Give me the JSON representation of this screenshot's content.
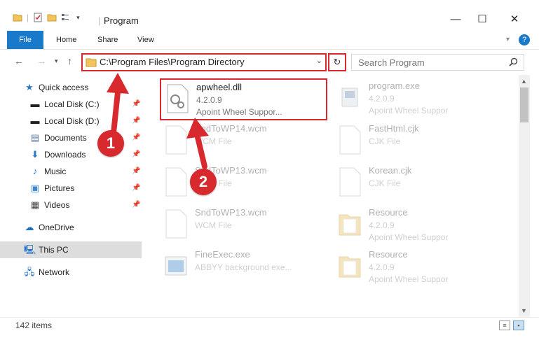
{
  "window": {
    "title": "Program",
    "minimize": "—",
    "maximize": "☐",
    "close": "✕"
  },
  "ribbon": {
    "tabs": [
      "File",
      "Home",
      "Share",
      "View"
    ],
    "help": "?"
  },
  "address": {
    "path": "C:\\Program Files\\Program Directory",
    "search_placeholder": "Search Program"
  },
  "nav_pane": {
    "items": [
      {
        "label": "Quick access",
        "icon": "star-icon"
      },
      {
        "label": "Local Disk (C:)",
        "icon": "disk-icon",
        "pinned": true
      },
      {
        "label": "Local Disk (D:)",
        "icon": "disk-icon",
        "pinned": true
      },
      {
        "label": "Documents",
        "icon": "documents-icon",
        "pinned": true
      },
      {
        "label": "Downloads",
        "icon": "download-icon",
        "pinned": true
      },
      {
        "label": "Music",
        "icon": "music-icon",
        "pinned": true
      },
      {
        "label": "Pictures",
        "icon": "pictures-icon",
        "pinned": true
      },
      {
        "label": "Videos",
        "icon": "videos-icon",
        "pinned": true
      },
      {
        "label": "OneDrive",
        "icon": "cloud-icon"
      },
      {
        "label": "This PC",
        "icon": "computer-icon",
        "selected": true
      },
      {
        "label": "Network",
        "icon": "network-icon"
      }
    ]
  },
  "files": [
    {
      "name": "apwheel.dll",
      "line2": "4.2.0.9",
      "line3": "Apoint Wheel Suppor...",
      "type": "dll",
      "highlighted": true
    },
    {
      "name": "program.exe",
      "line2": "4.2.0.9",
      "line3": "Apoint Wheel Suppor",
      "type": "exe"
    },
    {
      "name": "SndToWP14.wcm",
      "line2": "WCM File",
      "line3": "",
      "type": "blank"
    },
    {
      "name": "FastHtml.cjk",
      "line2": "CJK File",
      "line3": "",
      "type": "blank"
    },
    {
      "name": "SndToWP13.wcm",
      "line2": "WCM File",
      "line3": "",
      "type": "blank"
    },
    {
      "name": "Korean.cjk",
      "line2": "CJK File",
      "line3": "",
      "type": "blank"
    },
    {
      "name": "SndToWP13.wcm",
      "line2": "WCM File",
      "line3": "",
      "type": "blank"
    },
    {
      "name": "Resource",
      "line2": "4.2.0.9",
      "line3": "Apoint Wheel Suppor",
      "type": "folder"
    },
    {
      "name": "FineExec.exe",
      "line2": "ABBYY background exe...",
      "line3": "",
      "type": "app"
    },
    {
      "name": "Resource",
      "line2": "4.2.0.9",
      "line3": "Apoint Wheel Suppor",
      "type": "folder"
    }
  ],
  "status": {
    "count": "142 items"
  },
  "annotations": {
    "badge1": "1",
    "badge2": "2"
  },
  "colors": {
    "accent": "#1979ca",
    "highlight": "#d8292f",
    "selected": "#dddddd"
  }
}
